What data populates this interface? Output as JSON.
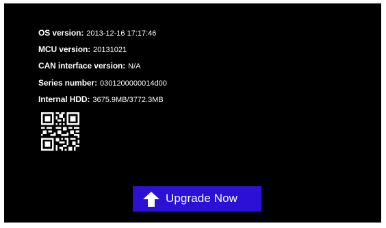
{
  "info": {
    "os_label": "OS version:",
    "os_value": "2013-12-16 17:17:46",
    "mcu_label": "MCU version:",
    "mcu_value": "20131021",
    "can_label": "CAN interface version:",
    "can_value": "N/A",
    "series_label": "Series number:",
    "series_value": "0301200000014d00",
    "hdd_label": "Internal HDD:",
    "hdd_value": "3675.9MB/3772.3MB"
  },
  "qr_icon": "qr-code-icon",
  "upgrade_button": {
    "label": "Upgrade Now",
    "icon": "up-arrow-icon",
    "color": "#2d10d6"
  },
  "colors": {
    "background": "#000000",
    "text": "#ffffff"
  }
}
